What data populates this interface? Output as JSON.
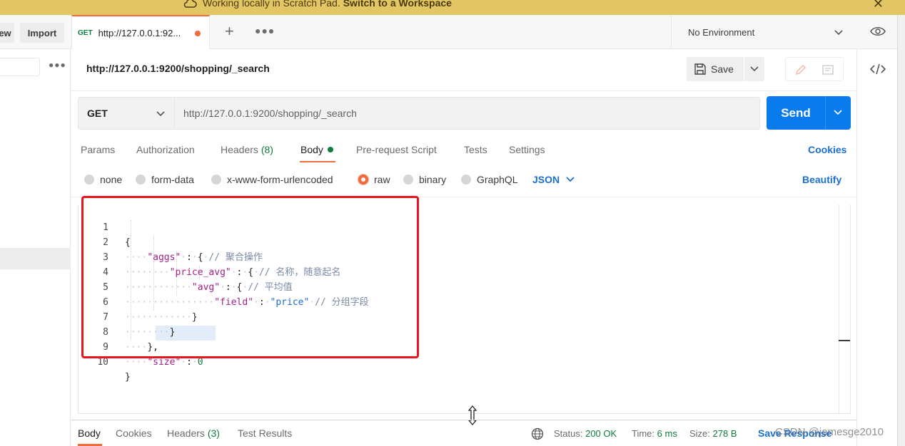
{
  "banner": {
    "text": "Working locally in Scratch Pad.",
    "link": "Switch to a Workspace"
  },
  "toolbar": {
    "new_label": "ew",
    "import_label": "Import"
  },
  "tab": {
    "method": "GET",
    "title": "http://127.0.0.1:92..."
  },
  "environment": {
    "label": "No Environment"
  },
  "request": {
    "title": "http://127.0.0.1:9200/shopping/_search",
    "save_label": "Save",
    "method": "GET",
    "url": "http://127.0.0.1:9200/shopping/_search",
    "send_label": "Send"
  },
  "request_tabs": {
    "params": "Params",
    "authorization": "Authorization",
    "headers": "Headers",
    "headers_count": "(8)",
    "body": "Body",
    "pre_request": "Pre-request Script",
    "tests": "Tests",
    "settings": "Settings",
    "cookies": "Cookies"
  },
  "body_types": {
    "none": "none",
    "form_data": "form-data",
    "urlencoded": "x-www-form-urlencoded",
    "raw": "raw",
    "binary": "binary",
    "graphql": "GraphQL",
    "format": "JSON",
    "beautify": "Beautify",
    "selected": "raw"
  },
  "code": {
    "lines": [
      {
        "n": "1"
      },
      {
        "n": "2",
        "key": "\"aggs\"",
        "comment": "// 聚合操作"
      },
      {
        "n": "3",
        "key": "\"price_avg\"",
        "comment": "// 名称，随意起名"
      },
      {
        "n": "4",
        "key": "\"avg\"",
        "comment": "// 平均值"
      },
      {
        "n": "5",
        "key": "\"field\"",
        "value": "\"price\"",
        "comment": "// 分组字段"
      },
      {
        "n": "6"
      },
      {
        "n": "7"
      },
      {
        "n": "8"
      },
      {
        "n": "9",
        "key": "\"size\"",
        "value": "0"
      },
      {
        "n": "10"
      }
    ]
  },
  "response": {
    "body": "Body",
    "cookies": "Cookies",
    "headers": "Headers",
    "headers_count": "(3)",
    "test_results": "Test Results",
    "status_label": "Status:",
    "status_value": "200 OK",
    "time_label": "Time:",
    "time_value": "6 ms",
    "size_label": "Size:",
    "size_value": "278 B",
    "save_response": "Save Response"
  },
  "watermark": "CSDN @jamesge2010",
  "colors": {
    "accent": "#f26b3a",
    "send": "#097bed",
    "link": "#1a6fd1",
    "ok": "#0f7b3d",
    "banner": "#e3c664",
    "annotation": "#e8161c"
  }
}
